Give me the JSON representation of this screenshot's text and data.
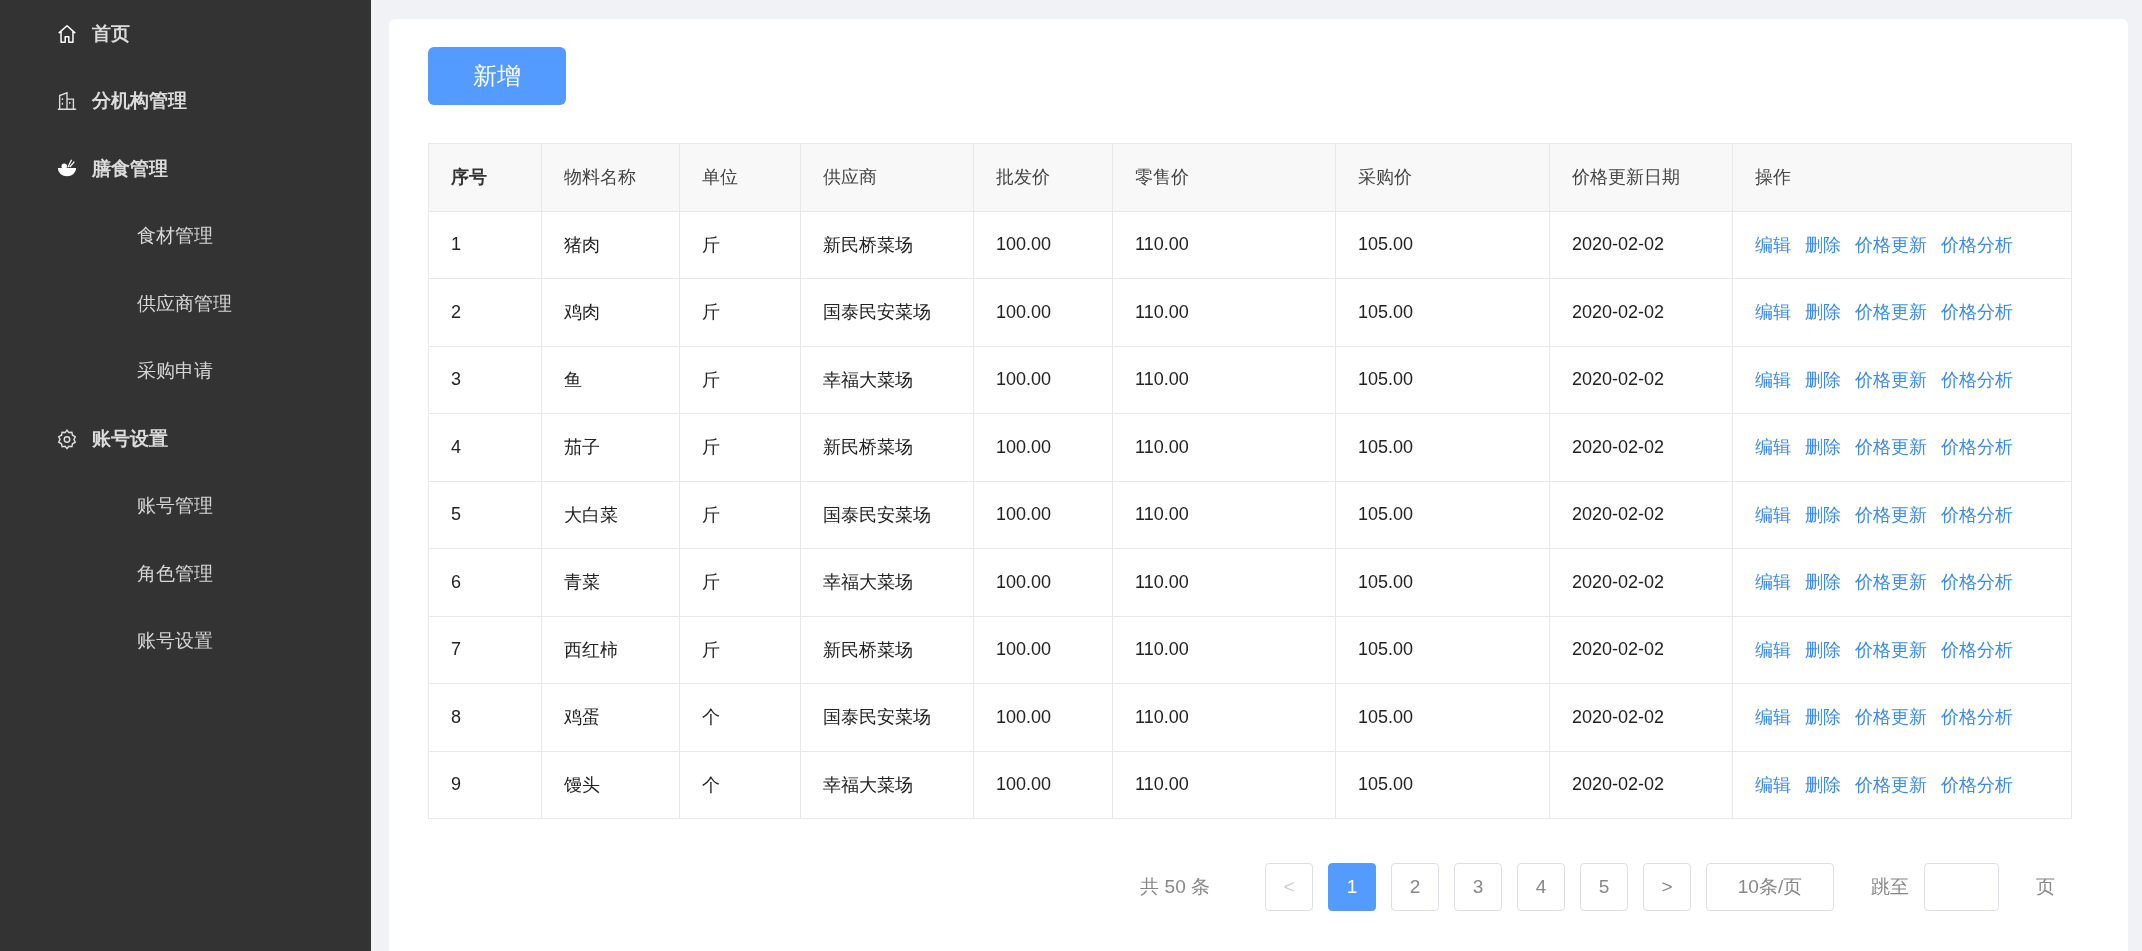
{
  "sidebar": {
    "items": [
      {
        "label": "首页"
      },
      {
        "label": "分机构管理"
      },
      {
        "label": "膳食管理",
        "children": [
          {
            "label": "食材管理"
          },
          {
            "label": "供应商管理"
          },
          {
            "label": "采购申请"
          }
        ]
      },
      {
        "label": "账号设置",
        "children": [
          {
            "label": "账号管理"
          },
          {
            "label": "角色管理"
          },
          {
            "label": "账号设置"
          }
        ]
      }
    ]
  },
  "toolbar": {
    "add_button": "新增"
  },
  "table": {
    "columns": [
      {
        "label": "序号",
        "bold": true
      },
      {
        "label": "物料名称",
        "bold": false
      },
      {
        "label": "单位",
        "bold": false
      },
      {
        "label": "供应商",
        "bold": false
      },
      {
        "label": "批发价",
        "bold": false
      },
      {
        "label": "零售价",
        "bold": false
      },
      {
        "label": "采购价",
        "bold": false
      },
      {
        "label": "价格更新日期",
        "bold": false
      },
      {
        "label": "操作",
        "bold": false
      }
    ],
    "rows": [
      {
        "cells": [
          "1",
          "猪肉",
          "斤",
          "新民桥菜场",
          "100.00",
          "110.00",
          "105.00",
          "2020-02-02"
        ],
        "actions": [
          "编辑",
          "删除",
          "价格更新",
          "价格分析"
        ]
      },
      {
        "cells": [
          "2",
          "鸡肉",
          "斤",
          "国泰民安菜场",
          "100.00",
          "110.00",
          "105.00",
          "2020-02-02"
        ],
        "actions": [
          "编辑",
          "删除",
          "价格更新",
          "价格分析"
        ]
      },
      {
        "cells": [
          "3",
          "鱼",
          "斤",
          "幸福大菜场",
          "100.00",
          "110.00",
          "105.00",
          "2020-02-02"
        ],
        "actions": [
          "编辑",
          "删除",
          "价格更新",
          "价格分析"
        ]
      },
      {
        "cells": [
          "4",
          "茄子",
          "斤",
          "新民桥菜场",
          "100.00",
          "110.00",
          "105.00",
          "2020-02-02"
        ],
        "actions": [
          "编辑",
          "删除",
          "价格更新",
          "价格分析"
        ]
      },
      {
        "cells": [
          "5",
          "大白菜",
          "斤",
          "国泰民安菜场",
          "100.00",
          "110.00",
          "105.00",
          "2020-02-02"
        ],
        "actions": [
          "编辑",
          "删除",
          "价格更新",
          "价格分析"
        ]
      },
      {
        "cells": [
          "6",
          "青菜",
          "斤",
          "幸福大菜场",
          "100.00",
          "110.00",
          "105.00",
          "2020-02-02"
        ],
        "actions": [
          "编辑",
          "删除",
          "价格更新",
          "价格分析"
        ]
      },
      {
        "cells": [
          "7",
          "西红柿",
          "斤",
          "新民桥菜场",
          "100.00",
          "110.00",
          "105.00",
          "2020-02-02"
        ],
        "actions": [
          "编辑",
          "删除",
          "价格更新",
          "价格分析"
        ]
      },
      {
        "cells": [
          "8",
          "鸡蛋",
          "个",
          "国泰民安菜场",
          "100.00",
          "110.00",
          "105.00",
          "2020-02-02"
        ],
        "actions": [
          "编辑",
          "删除",
          "价格更新",
          "价格分析"
        ]
      },
      {
        "cells": [
          "9",
          "馒头",
          "个",
          "幸福大菜场",
          "100.00",
          "110.00",
          "105.00",
          "2020-02-02"
        ],
        "actions": [
          "编辑",
          "删除",
          "价格更新",
          "价格分析"
        ]
      }
    ]
  },
  "pagination": {
    "total": "共 50 条",
    "prev": {
      "label": "<",
      "disabled": true
    },
    "pages": [
      {
        "label": "1",
        "selected": true
      },
      {
        "label": "2",
        "selected": false
      },
      {
        "label": "3",
        "selected": false
      },
      {
        "label": "4",
        "selected": false
      },
      {
        "label": "5",
        "selected": false
      }
    ],
    "next": {
      "label": ">",
      "disabled": false
    },
    "page_size": "10条/页",
    "jump_label": "跳至",
    "jump_suffix": "页"
  }
}
